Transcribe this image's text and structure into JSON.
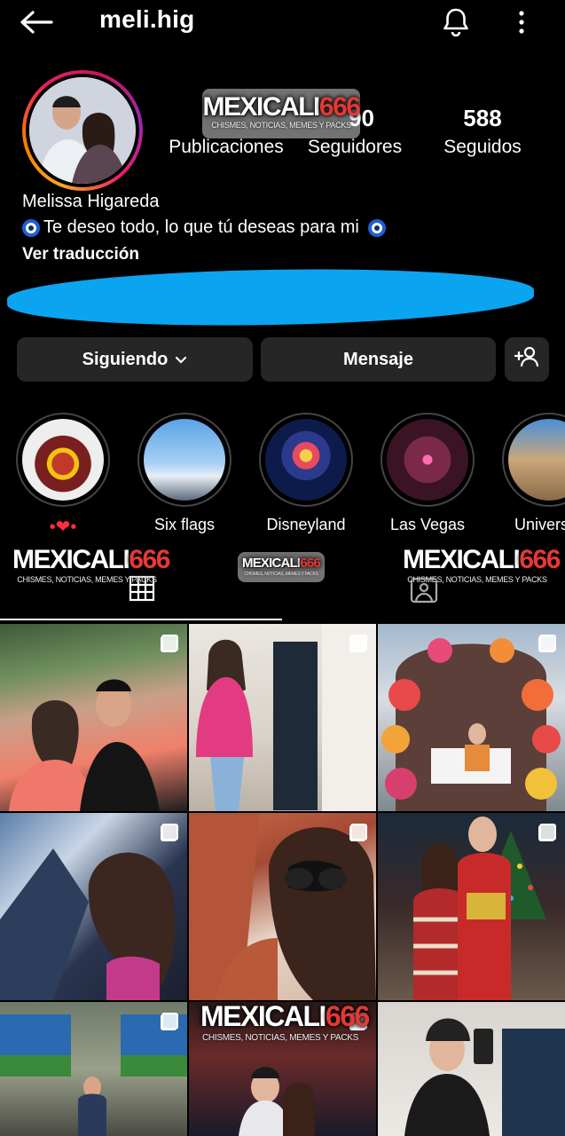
{
  "header": {
    "username": "meli.hig"
  },
  "stats": [
    {
      "value": "",
      "label": "Publicaciones"
    },
    {
      "value": "90",
      "label": "Seguidores"
    },
    {
      "value": "588",
      "label": "Seguidos"
    }
  ],
  "bio": {
    "name": "Melissa Higareda",
    "text": "Te deseo todo, lo que tú deseas para mi",
    "translate": "Ver traducción"
  },
  "actions": {
    "following": "Siguiendo",
    "message": "Mensaje"
  },
  "highlights": [
    {
      "label": "•❤•"
    },
    {
      "label": "Six flags"
    },
    {
      "label": "Disneyland"
    },
    {
      "label": "Las Vegas"
    },
    {
      "label": "Univers"
    }
  ],
  "watermark": {
    "brand_white": "MEXICALI",
    "brand_red": "666",
    "tagline": "CHISMES, NOTICIAS, MEMES Y PACKS"
  },
  "colors": {
    "background": "#000000",
    "button": "#262626",
    "story_ring": "#e91e63",
    "watermark_red": "#e53935",
    "redaction": "#0aa4f0"
  },
  "icons": [
    "back-arrow-icon",
    "bell-icon",
    "more-icon",
    "chevron-down-icon",
    "add-person-icon",
    "grid-icon",
    "tagged-icon",
    "multi-post-icon"
  ]
}
